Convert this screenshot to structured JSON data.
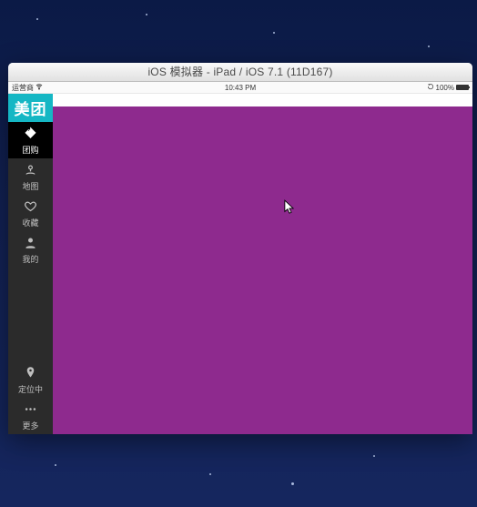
{
  "window": {
    "title": "iOS 模拟器 - iPad / iOS 7.1 (11D167)"
  },
  "statusbar": {
    "carrier": "运营商",
    "time": "10:43 PM",
    "battery": "100%"
  },
  "app": {
    "logo": "美团",
    "nav": {
      "groupbuy": "团购",
      "map": "地图",
      "favorites": "收藏",
      "mine": "我的",
      "locating": "定位中",
      "more": "更多"
    },
    "colors": {
      "brand": "#15b7c4",
      "content_bg": "#8e2a8e"
    }
  }
}
